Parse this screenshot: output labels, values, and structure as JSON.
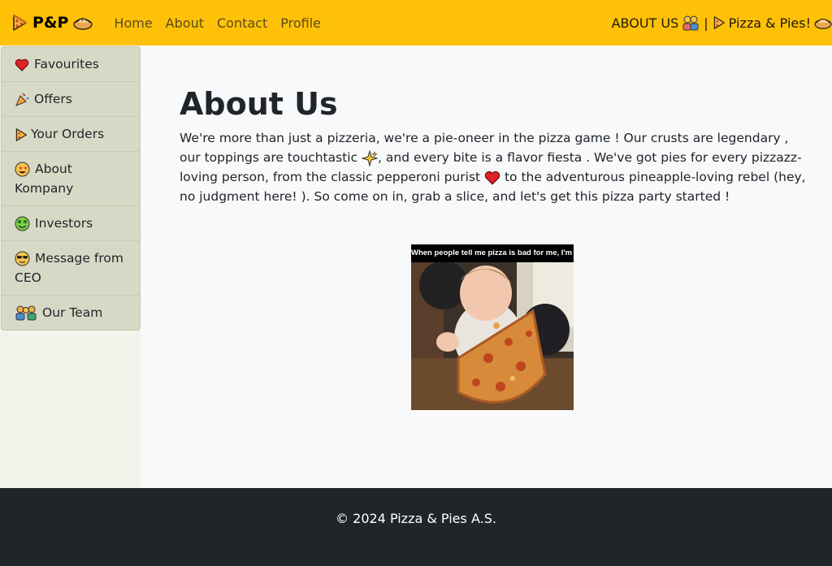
{
  "navbar": {
    "brand": {
      "icon_left": "pizza-icon",
      "text": "P&P",
      "icon_right": "pie-icon"
    },
    "links": [
      "Home",
      "About",
      "Contact",
      "Profile"
    ],
    "right": {
      "text_left": "ABOUT US",
      "icon_left": "family-icon",
      "separator": "|",
      "icon_pizza": "pizza-icon",
      "text_right": "Pizza & Pies!",
      "icon_right": "pie-icon"
    },
    "color": "#ffc107"
  },
  "sidebar": {
    "items": [
      {
        "icon": "heart-icon",
        "label": "Favourites"
      },
      {
        "icon": "party-popper-icon",
        "label": "Offers"
      },
      {
        "icon": "pizza-icon",
        "label": "Your Orders"
      },
      {
        "icon": "star-eyes-icon",
        "label": "About Kompany"
      },
      {
        "icon": "money-face-icon",
        "label": "Investors"
      },
      {
        "icon": "sunglasses-face-icon",
        "label": "Message from CEO"
      },
      {
        "icon": "team-icon",
        "label": "Our Team"
      }
    ]
  },
  "main": {
    "title": "About Us",
    "paragraph": {
      "part1": "We're more than just a pizzeria, we're a pie-oneer in the pizza game ! Our crusts are legendary , our toppings are touchtastic ",
      "part2": ", and every bite is a flavor fiesta . We've got pies for every pizzazz-loving person, from the classic pepperoni purist ",
      "part3": " to the adventurous pineapple-loving rebel (hey, no judgment here! ). So come on in, grab a slice, and let's get this pizza party started !",
      "icon_sparkle": "sparkles-icon",
      "icon_heart": "heart-icon"
    },
    "meme": {
      "caption": "When people tell me pizza is bad for me, I'm like..."
    }
  },
  "footer": {
    "text": "© 2024 Pizza & Pies A.S."
  }
}
